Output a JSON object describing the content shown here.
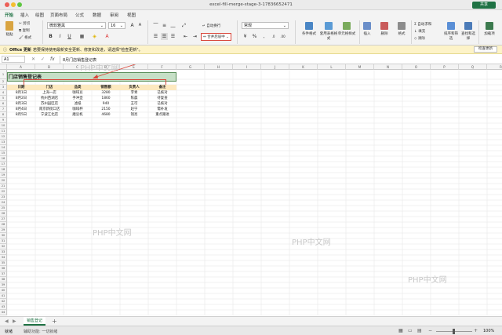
{
  "window": {
    "title": "excel-fill-merge-stage-3-17836652471",
    "share_label": "共享"
  },
  "menu_tabs": [
    "开始",
    "插入",
    "绘图",
    "页面布局",
    "公式",
    "数据",
    "审阅",
    "视图"
  ],
  "ribbon": {
    "paste": "粘贴",
    "cut": "剪切",
    "copy": "复制",
    "format_painter": "格式",
    "font_name": "微软雅黑",
    "font_size": "16",
    "wrap_text": "自动换行",
    "merge_center": "合并后居中",
    "number_format": "常规",
    "conditional_format": "条件格式",
    "format_as_table": "套用表格格式",
    "cell_styles": "单元格样式",
    "insert": "插入",
    "delete": "删除",
    "format": "格式",
    "autosum": "自动求和",
    "fill": "填充",
    "clear": "清除",
    "sort_filter": "排序和筛选",
    "find_select": "查找和选择",
    "addins": "加载项"
  },
  "message_bar": {
    "label": "Office 更新",
    "text": "若要保持使用最新安全更新、修复和改进，请选择\"检查更新\"。",
    "button": "检查更新"
  },
  "formula_bar": {
    "name_box": "A1",
    "fx": "fx",
    "content": "8月门店销售登记表"
  },
  "columns": [
    "A",
    "B",
    "C",
    "D",
    "E",
    "F",
    "G",
    "H",
    "I",
    "J",
    "K",
    "L",
    "M",
    "N",
    "O",
    "P",
    "Q",
    "R"
  ],
  "sheet": {
    "title_cell": "门店销售登记表",
    "headers": [
      "日期",
      "门店",
      "品类",
      "销售额",
      "负责人",
      "备注"
    ],
    "rows": [
      [
        "8月1日",
        "上海一店",
        "咖啡豆",
        "3280",
        "李青",
        "已核对"
      ],
      [
        "8月2日",
        "杭州西湖店",
        "手冲壶",
        "1860",
        "陈晨",
        "待复查"
      ],
      [
        "8月3日",
        "苏州园区店",
        "滤纸",
        "940",
        "王可",
        "已核对"
      ],
      [
        "8月4日",
        "南京新街口店",
        "咖啡杯",
        "2150",
        "赵宁",
        "需补发"
      ],
      [
        "8月5日",
        "宁波江北店",
        "磨豆机",
        "4680",
        "钱亮",
        "重点跟进"
      ]
    ]
  },
  "watermark": "PHP中文网",
  "sheet_tabs": [
    "销售登记"
  ],
  "status": {
    "ready": "就绪",
    "accessibility": "辅助功能: 一切就绪",
    "zoom": "100%"
  },
  "colors": {
    "accent": "#1f7244",
    "header_fill": "#fde9c0",
    "title_fill": "#c6dfc6",
    "annotation": "#d9463a"
  }
}
